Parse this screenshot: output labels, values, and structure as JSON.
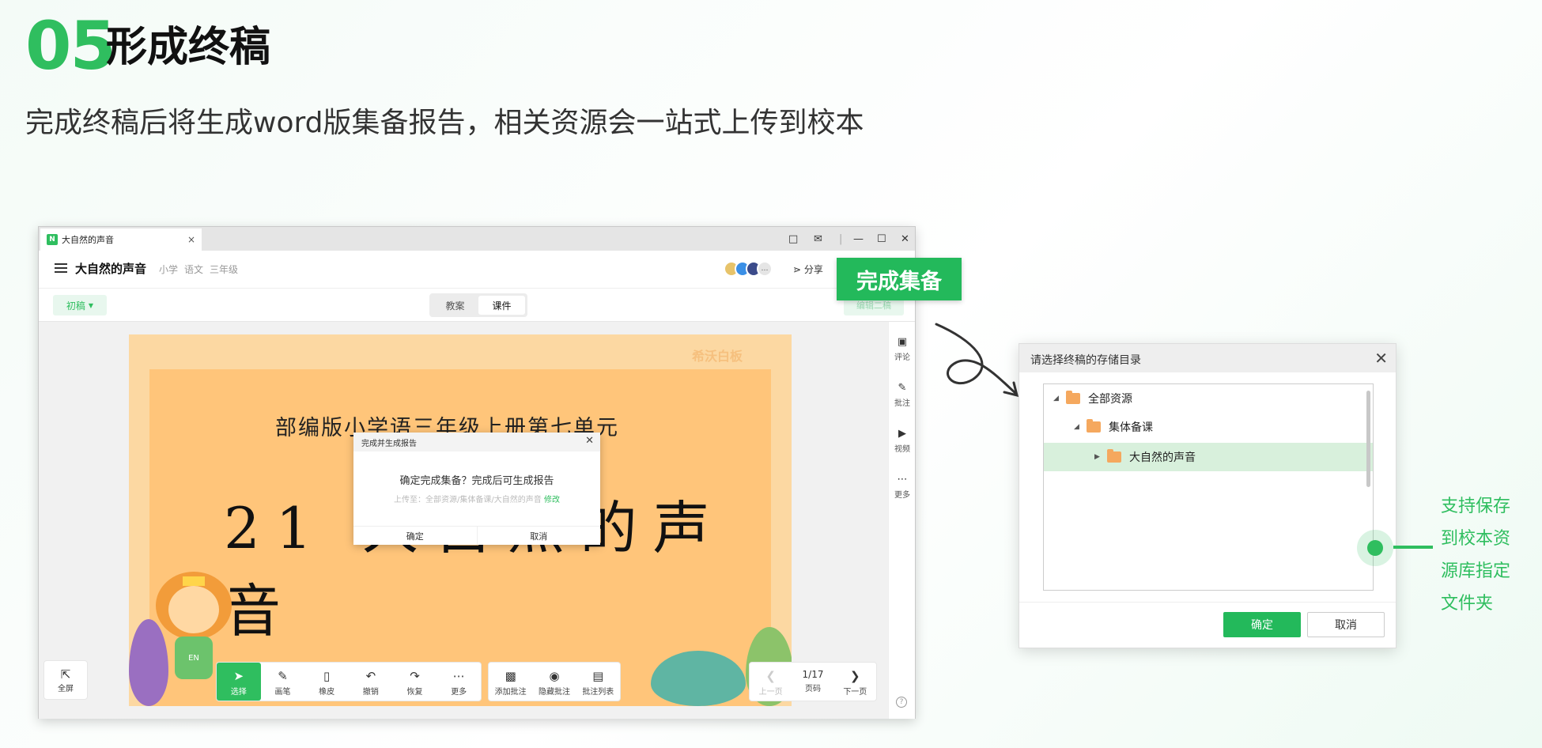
{
  "header": {
    "number": "05",
    "title": "形成终稿",
    "subtitle": "完成终稿后将生成word版集备报告，相关资源会一站式上传到校本"
  },
  "window": {
    "tab_title": "大自然的声音",
    "tab_logo": "N",
    "doc_title": "大自然的声音",
    "tags": [
      "小学",
      "语文",
      "三年级"
    ],
    "share_label": "分享",
    "draft_label": "初稿",
    "segments": [
      "教案",
      "课件"
    ],
    "active_segment": "课件",
    "edit_label": "编辑二稿",
    "right_tools": [
      {
        "icon": "comment-icon",
        "label": "评论"
      },
      {
        "icon": "annotate-icon",
        "label": "批注"
      },
      {
        "icon": "video-icon",
        "label": "视频"
      },
      {
        "icon": "more-icon",
        "label": "更多"
      }
    ]
  },
  "slide": {
    "watermark": "希沃白板",
    "line1": "部编版小学语三年级上册第七单元",
    "line2": "21 大自然的声音",
    "badge": "EN"
  },
  "confirm_dialog": {
    "title": "完成并生成报告",
    "question": "确定完成集备？完成后可生成报告",
    "path_prefix": "上传至：全部资源/集体备课/大自然的声音",
    "modify": "修改",
    "ok": "确定",
    "cancel": "取消"
  },
  "bottom": {
    "fullscreen": "全屏",
    "tools": [
      {
        "icon": "select-icon",
        "label": "选择",
        "active": true
      },
      {
        "icon": "pen-icon",
        "label": "画笔"
      },
      {
        "icon": "eraser-icon",
        "label": "橡皮"
      },
      {
        "icon": "undo-icon",
        "label": "撤销"
      },
      {
        "icon": "redo-icon",
        "label": "恢复"
      },
      {
        "icon": "more-icon",
        "label": "更多"
      }
    ],
    "tools2": [
      {
        "icon": "add-annotation-icon",
        "label": "添加批注"
      },
      {
        "icon": "hide-annotation-icon",
        "label": "隐藏批注"
      },
      {
        "icon": "annotation-list-icon",
        "label": "批注列表"
      }
    ],
    "prev": "上一页",
    "page": "1/17",
    "page_label": "页码",
    "next": "下一页"
  },
  "done_button": "完成集备",
  "folder_dialog": {
    "title": "请选择终稿的存储目录",
    "tree": [
      {
        "label": "全部资源",
        "level": 0,
        "caret": "down"
      },
      {
        "label": "集体备课",
        "level": 1,
        "caret": "down"
      },
      {
        "label": "大自然的声音",
        "level": 2,
        "caret": "right",
        "selected": true
      }
    ],
    "ok": "确定",
    "cancel": "取消"
  },
  "annotation": {
    "lines": [
      "支持保存",
      "到校本资",
      "源库指定",
      "文件夹"
    ]
  },
  "colors": {
    "accent": "#2fbe5f",
    "slide_bg": "#ffc57a"
  }
}
